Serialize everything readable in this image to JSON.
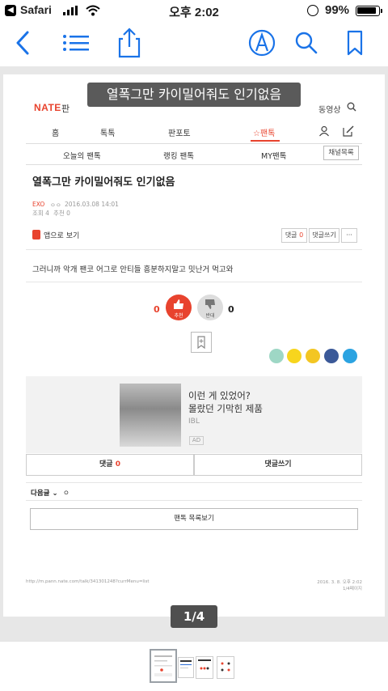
{
  "status_bar": {
    "carrier": "Safari",
    "time": "오후 2:02",
    "battery_percent": "99%"
  },
  "toolbar": {
    "back_icon": "chevron-left-icon",
    "list_icon": "list-icon",
    "share_icon": "share-icon",
    "markup_icon": "markup-pen-icon",
    "search_icon": "search-icon",
    "bookmark_icon": "bookmark-icon",
    "accent_color": "#1a73e8"
  },
  "document": {
    "title_overlay": "열폭그만 카이밀어줘도 인기없음",
    "page_indicator": "1/4",
    "header": {
      "logo": "NATE",
      "section": "판",
      "video_link": "동영상"
    },
    "nav_tabs": [
      {
        "label": "홈"
      },
      {
        "label": "톡톡"
      },
      {
        "label": "판포토"
      },
      {
        "label": "☆팬톡"
      }
    ],
    "sub_tabs": [
      {
        "label": "오늘의 팬톡"
      },
      {
        "label": "랭킹 팬톡"
      },
      {
        "label": "MY팬톡"
      }
    ],
    "channel_list_button": "채널목록",
    "post": {
      "title": "열폭그만 카이밀어줘도 인기없음",
      "channel": "EXO",
      "author": "ㅇㅇ",
      "date": "2016.03.08 14:01",
      "views": "조회 4",
      "recommends": "추천 0",
      "app_view": "앱으로 보기",
      "comment_label": "댓글",
      "comment_count": "0",
      "write_comment": "댓글쓰기",
      "more": "···",
      "body": "그러니까 악개 팬코 어그로 안티들 흥분하지말고 밋난거 먹고와",
      "upvote_count": "0",
      "upvote_label": "추천",
      "downvote_count": "0",
      "downvote_label": "반대"
    },
    "ad": {
      "line1": "이런 게 있었어?",
      "line2": "몰랐던 기막힌 제품",
      "brand": "IBL",
      "tag": "AD"
    },
    "comment_tabs": {
      "comments_label": "댓글",
      "comments_count": "0",
      "write_label": "댓글쓰기"
    },
    "next_post": {
      "label": "다음글",
      "value": "ㅇ"
    },
    "list_button": "팬톡 목록보기",
    "footer_url": "http://m.pann.nate.com/talk/341301248?currMenu=list",
    "footer_date": "2016. 3. 8. 오후 2:02",
    "footer_page": "1/4페이지"
  },
  "thumbnails": {
    "count": 4,
    "active_index": 0
  }
}
